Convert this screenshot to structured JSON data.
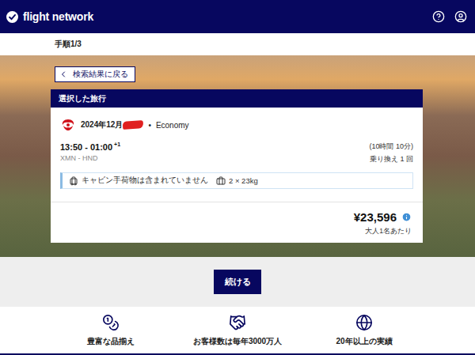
{
  "header": {
    "logo": "flight network"
  },
  "step": "手順1/3",
  "back_button": "検索結果に戻る",
  "card": {
    "title": "選択した旅行",
    "date": "2024年12月",
    "separator": "•",
    "cabin": "Economy",
    "times": "13:50 - 01:00",
    "day_offset": "+1",
    "route": "XMN - HND",
    "duration": "(10時間 10分)",
    "stops": "乗り換え 1 回",
    "baggage": [
      {
        "kind": "cabin",
        "label": "キャビン手荷物は含まれていません"
      },
      {
        "kind": "checked",
        "label": "2 × 23kg"
      }
    ],
    "price": "¥23,596",
    "price_note": "大人1名あたり"
  },
  "continue_button": "続ける",
  "features": [
    {
      "kind": "coins",
      "label": "豊富な品揃え"
    },
    {
      "kind": "handshake",
      "label": "お客様数は毎年3000万人"
    },
    {
      "kind": "globe",
      "label": "20年以上の実績"
    }
  ]
}
